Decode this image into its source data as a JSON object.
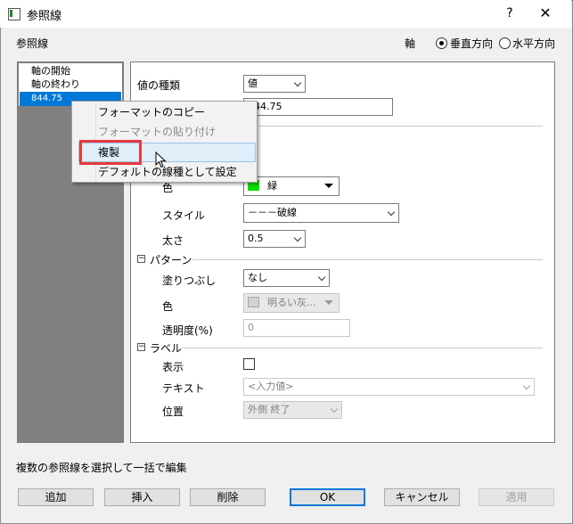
{
  "window": {
    "title": "参照線",
    "help": "?",
    "close": "✕"
  },
  "header": {
    "section_label": "参照線",
    "axis_label": "軸",
    "radio_vertical": "垂直方向",
    "radio_horizontal": "水平方向",
    "selected_axis": "垂直方向"
  },
  "list": {
    "items": [
      "軸の開始",
      "軸の終わり",
      "844.75"
    ],
    "selected": "844.75"
  },
  "panel": {
    "value_type_label": "値の種類",
    "value_type_value": "値",
    "value_input": "844.75",
    "line": {
      "color_label": "色",
      "color_value": "緑",
      "color_swatch": "#00e000",
      "style_label": "スタイル",
      "style_value": "－－－破線",
      "width_label": "太さ",
      "width_value": "0.5"
    },
    "pattern": {
      "header": "パターン",
      "fill_label": "塗りつぶし",
      "fill_value": "なし",
      "color_label": "色",
      "color_value": "明るい灰...",
      "color_swatch": "#d3d3d3",
      "transparency_label": "透明度(%)",
      "transparency_value": "0"
    },
    "label": {
      "header": "ラベル",
      "show_label": "表示",
      "show_checked": false,
      "text_label": "テキスト",
      "text_placeholder": "<入力値>",
      "position_label": "位置",
      "position_value": "外側 終了"
    },
    "collapse_symbol": "⊟"
  },
  "context_menu": {
    "items": [
      {
        "label": "フォーマットのコピー",
        "enabled": true
      },
      {
        "label": "フォーマットの貼り付け",
        "enabled": false
      },
      {
        "label": "複製",
        "enabled": true,
        "highlighted": true
      },
      {
        "label": "デフォルトの線種として設定",
        "enabled": true
      }
    ]
  },
  "footer": {
    "hint": "複数の参照線を選択して一括で編集",
    "buttons": {
      "add": "追加",
      "insert": "挿入",
      "delete": "削除",
      "ok": "OK",
      "cancel": "キャンセル",
      "apply": "適用"
    }
  },
  "colors": {
    "selection": "#0078d7",
    "highlight_box": "#e8393d"
  }
}
